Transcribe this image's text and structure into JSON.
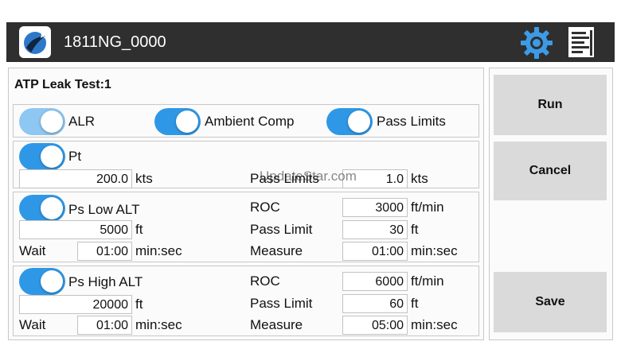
{
  "header": {
    "title": "1811NG_0000",
    "logo_icon": "globe-plane-logo",
    "settings_icon": "gear-icon",
    "report_icon": "document-icon",
    "colors": {
      "bar": "#2f2f2f",
      "accent": "#2f98e6"
    }
  },
  "test": {
    "title": "ATP Leak Test:1",
    "toggles": {
      "alr": {
        "label": "ALR",
        "on": true
      },
      "ambient_comp": {
        "label": "Ambient Comp",
        "on": true
      },
      "pass_limits": {
        "label": "Pass Limits",
        "on": true
      }
    },
    "pt": {
      "label": "Pt",
      "value": "200.0",
      "unit": "kts",
      "pass_label": "Pass Limits",
      "pass_value": "1.0",
      "pass_unit": "kts"
    },
    "ps_low": {
      "label": "Ps Low ALT",
      "value": "5000",
      "unit": "ft",
      "wait_label": "Wait",
      "wait_value": "01:00",
      "wait_unit": "min:sec",
      "roc_label": "ROC",
      "roc_value": "3000",
      "roc_unit": "ft/min",
      "pass_label": "Pass Limit",
      "pass_value": "30",
      "pass_unit": "ft",
      "measure_label": "Measure",
      "measure_value": "01:00",
      "measure_unit": "min:sec"
    },
    "ps_high": {
      "label": "Ps High ALT",
      "value": "20000",
      "unit": "ft",
      "wait_label": "Wait",
      "wait_value": "01:00",
      "wait_unit": "min:sec",
      "roc_label": "ROC",
      "roc_value": "6000",
      "roc_unit": "ft/min",
      "pass_label": "Pass Limit",
      "pass_value": "60",
      "pass_unit": "ft",
      "measure_label": "Measure",
      "measure_value": "05:00",
      "measure_unit": "min:sec"
    }
  },
  "actions": {
    "run": "Run",
    "cancel": "Cancel",
    "save": "Save"
  },
  "watermark": "UpdateStar.com"
}
